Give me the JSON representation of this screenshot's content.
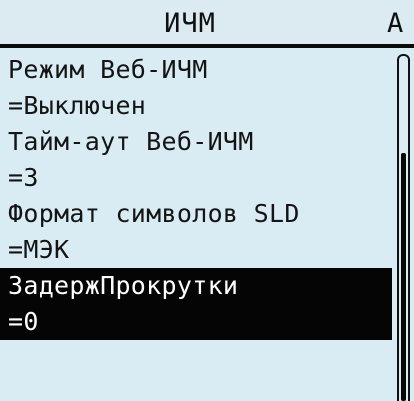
{
  "header": {
    "title": "ИЧМ",
    "next_tab_label": "A"
  },
  "menu": {
    "items": [
      {
        "label": "Режим Веб-ИЧМ",
        "value": "=Выключен",
        "selected": false
      },
      {
        "label": "Тайм-аут Веб-ИЧМ",
        "value": "=3",
        "selected": false
      },
      {
        "label": "Формат символов SLD",
        "value": "=МЭК",
        "selected": false
      },
      {
        "label": "ЗадержПрокрутки",
        "value": "=0",
        "selected": true
      }
    ]
  },
  "scrollbar": {
    "position_fraction": 0.28,
    "visible_fraction": 0.72
  },
  "colors": {
    "background": "#d9ecf4",
    "foreground": "#141414",
    "selection_background": "#050505",
    "selection_foreground": "#ffffff"
  }
}
